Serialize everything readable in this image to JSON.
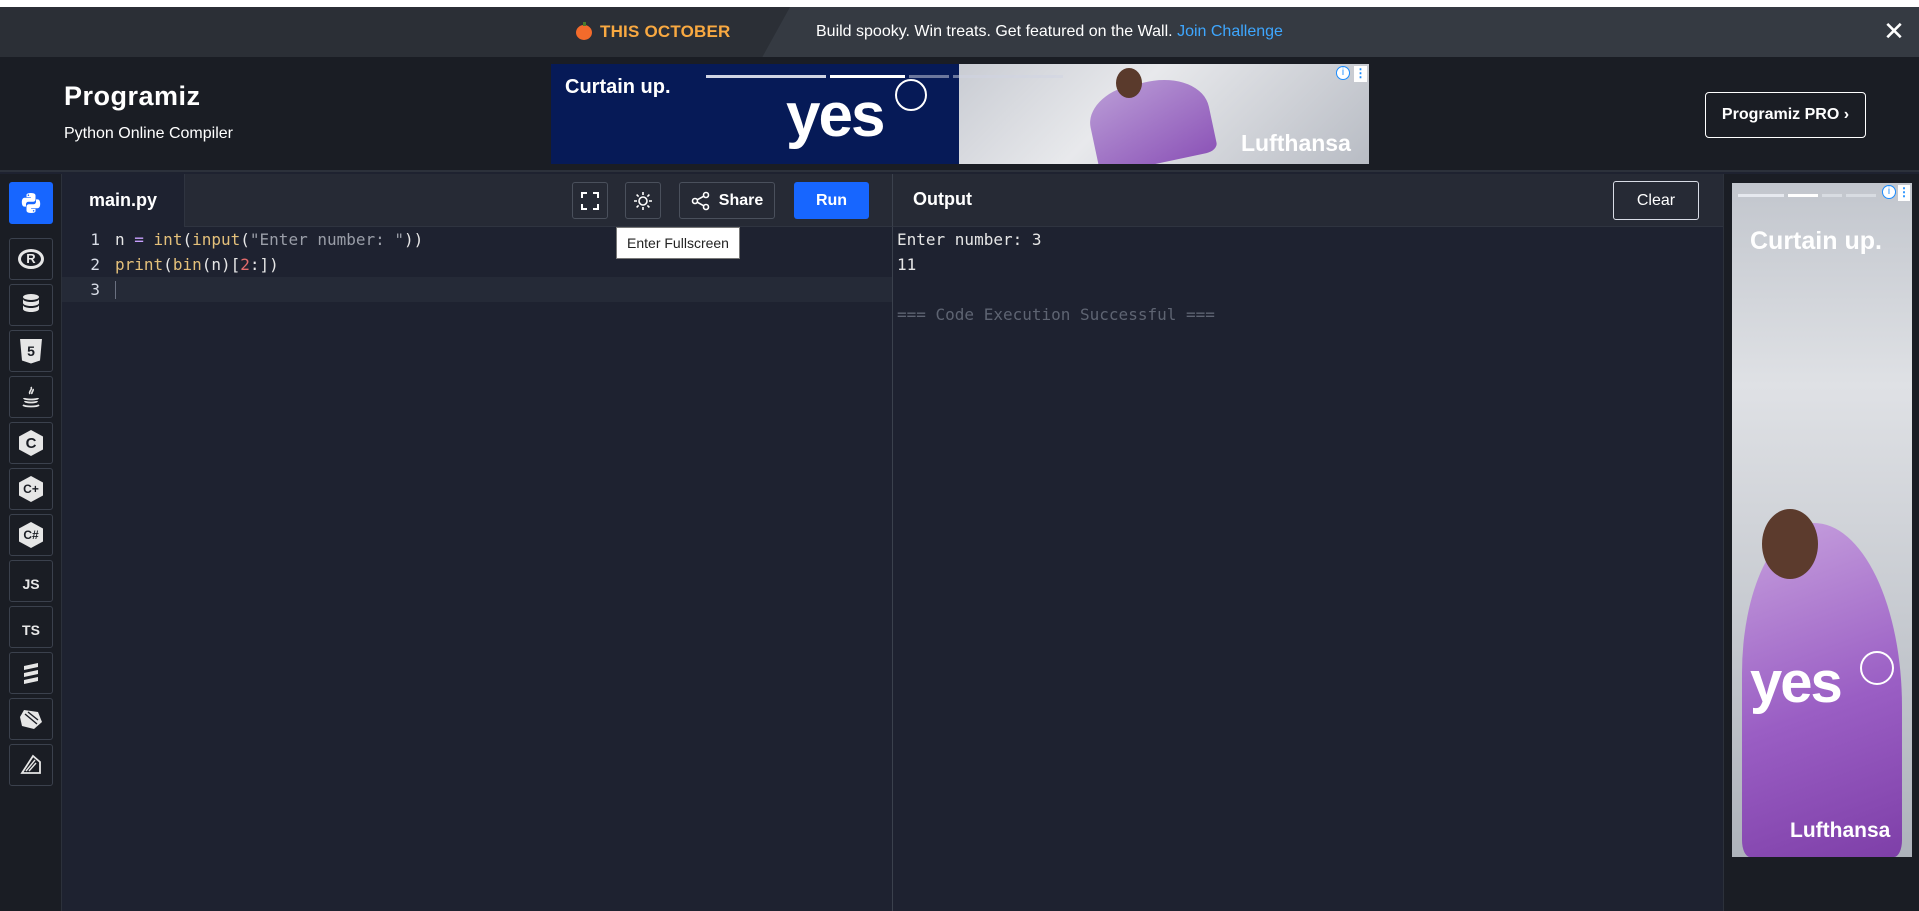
{
  "banner": {
    "tag": "THIS OCTOBER",
    "message": "Build spooky. Win treats. Get featured on the Wall.",
    "link": "Join Challenge",
    "close_icon": "close-icon"
  },
  "header": {
    "logo": "Programiz",
    "subtitle": "Python Online Compiler",
    "pro_button": "Programiz PRO ›"
  },
  "ad_top": {
    "headline": "Curtain up.",
    "slogan": "yes",
    "brand": "Lufthansa"
  },
  "sidebar": {
    "items": [
      {
        "name": "python",
        "label": "",
        "icon": "python-icon",
        "active": true
      },
      {
        "name": "r",
        "label": "R",
        "icon": "r-icon"
      },
      {
        "name": "sql",
        "label": "",
        "icon": "database-icon"
      },
      {
        "name": "html",
        "label": "5",
        "icon": "html5-icon"
      },
      {
        "name": "java",
        "label": "",
        "icon": "java-icon"
      },
      {
        "name": "c",
        "label": "C",
        "icon": "c-icon"
      },
      {
        "name": "cpp",
        "label": "C+",
        "icon": "cpp-icon"
      },
      {
        "name": "csharp",
        "label": "C#",
        "icon": "csharp-icon"
      },
      {
        "name": "javascript",
        "label": "JS",
        "icon": "js-icon"
      },
      {
        "name": "typescript",
        "label": "TS",
        "icon": "ts-icon"
      },
      {
        "name": "go",
        "label": "",
        "icon": "stack-icon"
      },
      {
        "name": "php",
        "label": "",
        "icon": "php-icon"
      },
      {
        "name": "swift",
        "label": "",
        "icon": "swift-icon"
      }
    ]
  },
  "editor": {
    "file_tab": "main.py",
    "share_label": "Share",
    "run_label": "Run",
    "tooltip": "Enter Fullscreen",
    "line_numbers": [
      "1",
      "2",
      "3"
    ],
    "lines": [
      "n = int(input(\"Enter number: \"))",
      "print(bin(n)[2:])",
      ""
    ]
  },
  "output": {
    "title": "Output",
    "clear_label": "Clear",
    "lines": [
      "Enter number: 3",
      "11",
      "",
      "=== Code Execution Successful ==="
    ]
  },
  "ad_side": {
    "headline": "Curtain up.",
    "slogan": "yes",
    "brand": "Lufthansa"
  },
  "colors": {
    "accent": "#1766ff",
    "banner_tag": "#f9a941",
    "link": "#3ea7ff",
    "editor_bg": "#1e2230"
  }
}
